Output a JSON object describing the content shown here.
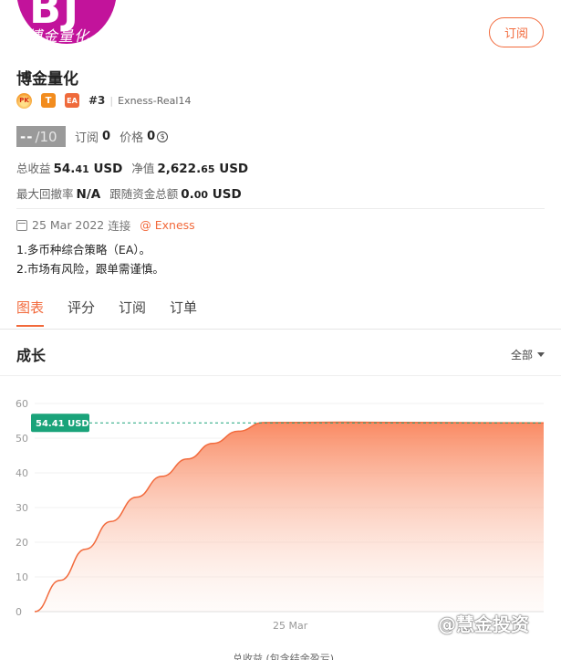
{
  "profile": {
    "avatar_text": "BJ",
    "avatar_caption": "博金量化",
    "name": "博金量化",
    "subscribe_label": "订阅",
    "badges": {
      "pk": "PK",
      "t": "T",
      "ea": "EA"
    },
    "rank": "#3",
    "account": "Exness-Real14"
  },
  "stats": {
    "score_dash": "--",
    "score_total": "/10",
    "subscriptions_label": "订阅",
    "subscriptions_value": "0",
    "price_label": "价格",
    "price_value": "0",
    "total_profit_label": "总收益",
    "total_profit_int": "54.",
    "total_profit_dec": "41",
    "total_profit_unit": "USD",
    "equity_label": "净值",
    "equity_int": "2,622.",
    "equity_dec": "65",
    "equity_unit": "USD",
    "drawdown_label": "最大回撤率",
    "drawdown_value": "N/A",
    "follow_label": "跟随资金总额",
    "follow_int": "0.",
    "follow_dec": "00",
    "follow_unit": "USD"
  },
  "connection": {
    "date": "25 Mar 2022",
    "connected_label": "连接",
    "broker": "@ Exness"
  },
  "description": [
    "1.多币种综合策略（EA）。",
    "2.市场有风险，跟单需谨慎。"
  ],
  "tabs": [
    {
      "label": "图表",
      "active": true
    },
    {
      "label": "评分",
      "active": false
    },
    {
      "label": "订阅",
      "active": false
    },
    {
      "label": "订单",
      "active": false
    }
  ],
  "growth": {
    "title": "成长",
    "range_label": "全部"
  },
  "chart_data": {
    "type": "area",
    "y_ticks": [
      0,
      10,
      20,
      30,
      40,
      50,
      60
    ],
    "ylim": [
      0,
      60
    ],
    "x_tick_labels": [
      "25 Mar"
    ],
    "current_label": "54.41 USD",
    "current_value": 54.41,
    "points": [
      {
        "x": 0.0,
        "y": 0
      },
      {
        "x": 0.05,
        "y": 9
      },
      {
        "x": 0.1,
        "y": 18
      },
      {
        "x": 0.15,
        "y": 26
      },
      {
        "x": 0.2,
        "y": 33
      },
      {
        "x": 0.25,
        "y": 39
      },
      {
        "x": 0.3,
        "y": 44
      },
      {
        "x": 0.35,
        "y": 48.5
      },
      {
        "x": 0.4,
        "y": 52
      },
      {
        "x": 0.45,
        "y": 54.5
      },
      {
        "x": 0.6,
        "y": 54.6
      },
      {
        "x": 0.8,
        "y": 54.5
      },
      {
        "x": 1.0,
        "y": 54.41
      }
    ],
    "colors": {
      "line": "#f26a3c",
      "fill_top": "#f9845b",
      "callout": "#1aa37a"
    }
  },
  "footer": {
    "legend_text": "总收益 (包含结余盈亏)",
    "watermark": "@慧金投资"
  }
}
